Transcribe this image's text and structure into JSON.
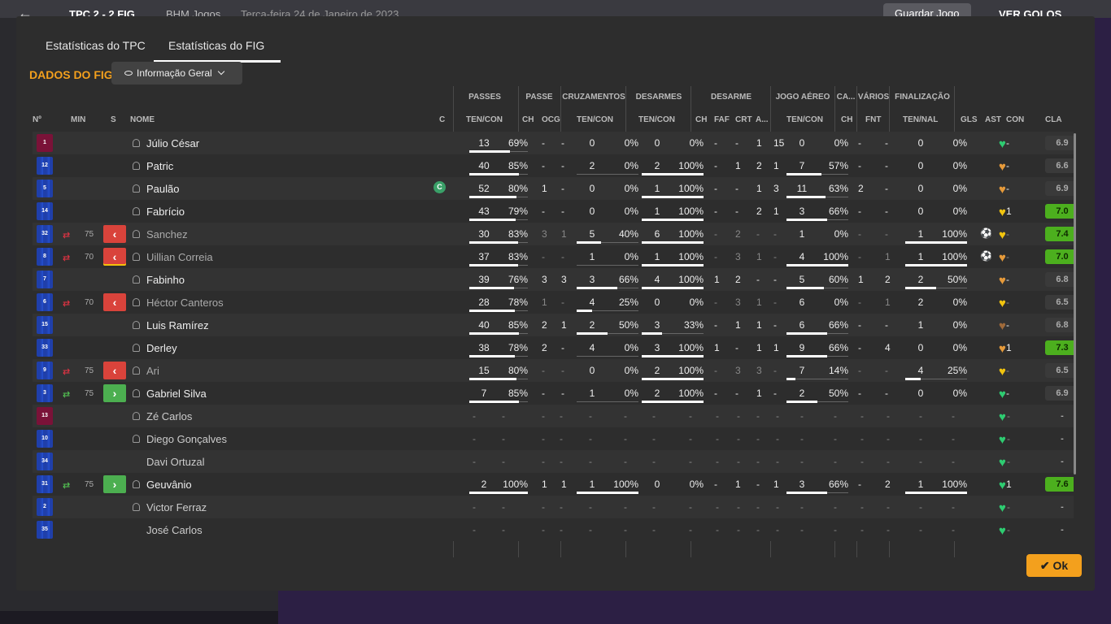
{
  "topbar": {
    "score": "TPC  2 - 2  FIG",
    "bhm": "BHM Jogos",
    "date": "Terça-feira 24 de Janeiro de 2023",
    "save": "Guardar Jogo",
    "goals": "VER GOLOS"
  },
  "tabs": [
    {
      "label": "Estatísticas do TPC"
    },
    {
      "label": "Estatísticas do FIG"
    }
  ],
  "section_title": "DADOS DO FIG",
  "dropdown": "Informação Geral",
  "groups": {
    "passes": "PASSES",
    "passe": "PASSE",
    "cruzamentos": "CRUZAMENTOS",
    "desarmes": "DESARMES",
    "desarme": "DESARME",
    "jogo_aereo": "JOGO AÉREO",
    "ca": "CA...",
    "varios": "VÁRIOS",
    "finalizacao": "FINALIZAÇÃO"
  },
  "headers": {
    "no": "Nº",
    "min": "MIN",
    "s": "S",
    "nome": "NOME",
    "c": "C",
    "passes": "TEN/CON",
    "pch": "CH",
    "pocg": "OCG",
    "cruz": "TEN/CON",
    "des": "TEN/CON",
    "dch": "CH",
    "dfaf": "FAF",
    "dcrt": "CRT",
    "da": "A...",
    "aereo": "TEN/CON",
    "cach": "CH",
    "fnt": "FNT",
    "fin": "TEN/NAL",
    "gls": "GLS",
    "ast": "AST",
    "con": "CON",
    "cla": "CLA"
  },
  "ok_label": "Ok",
  "colors": {
    "accent": "#f3a01d",
    "heart_green": "#2ecc71",
    "heart_yellow": "#f1c40f",
    "heart_orange": "#e69a3a",
    "rating_green": "#4caf1e"
  },
  "players": [
    {
      "no": "1",
      "gk": true,
      "name": "Júlio César",
      "pass": [
        "13",
        "69%"
      ],
      "pass_pct": 69,
      "pch": "-",
      "pocg": "-",
      "cruz": [
        "0",
        "0%"
      ],
      "cruz_pct": 0,
      "des": [
        "0",
        "0%"
      ],
      "des_pct": 0,
      "dch": "-",
      "dfaf": "-",
      "dcrt": "1",
      "da": "15",
      "aer": [
        "0",
        "0%"
      ],
      "aer_pct": 0,
      "cach": "-",
      "fnt": "-",
      "fin": [
        "0",
        "0%"
      ],
      "fin_pct": 0,
      "gls": "",
      "ast": "-",
      "con": "green",
      "cla": "6.9",
      "hi": false
    },
    {
      "no": "12",
      "name": "Patric",
      "pass": [
        "40",
        "85%"
      ],
      "pass_pct": 85,
      "pch": "-",
      "pocg": "-",
      "cruz": [
        "2",
        "0%"
      ],
      "cruz_pct": 0,
      "des": [
        "2",
        "100%"
      ],
      "des_pct": 100,
      "dch": "-",
      "dfaf": "1",
      "dcrt": "2",
      "da": "1",
      "aer": [
        "7",
        "57%"
      ],
      "aer_pct": 57,
      "cach": "-",
      "fnt": "-",
      "fin": [
        "0",
        "0%"
      ],
      "fin_pct": 0,
      "gls": "",
      "ast": "-",
      "con": "orange",
      "cla": "6.6",
      "hi": false
    },
    {
      "no": "5",
      "name": "Paulão",
      "captain": true,
      "pass": [
        "52",
        "80%"
      ],
      "pass_pct": 80,
      "pch": "1",
      "pocg": "-",
      "cruz": [
        "0",
        "0%"
      ],
      "cruz_pct": 0,
      "des": [
        "1",
        "100%"
      ],
      "des_pct": 100,
      "dch": "-",
      "dfaf": "-",
      "dcrt": "1",
      "da": "3",
      "aer": [
        "11",
        "63%"
      ],
      "aer_pct": 63,
      "cach": "2",
      "fnt": "-",
      "fin": [
        "0",
        "0%"
      ],
      "fin_pct": 0,
      "gls": "",
      "ast": "-",
      "con": "orange",
      "cla": "6.9",
      "hi": false
    },
    {
      "no": "14",
      "name": "Fabrício",
      "pass": [
        "43",
        "79%"
      ],
      "pass_pct": 79,
      "pch": "-",
      "pocg": "-",
      "cruz": [
        "0",
        "0%"
      ],
      "cruz_pct": 0,
      "des": [
        "1",
        "100%"
      ],
      "des_pct": 100,
      "dch": "-",
      "dfaf": "-",
      "dcrt": "2",
      "da": "1",
      "aer": [
        "3",
        "66%"
      ],
      "aer_pct": 66,
      "cach": "-",
      "fnt": "-",
      "fin": [
        "0",
        "0%"
      ],
      "fin_pct": 0,
      "gls": "",
      "ast": "1",
      "con": "yellow",
      "cla": "7.0",
      "hi": true
    },
    {
      "no": "32",
      "sub": "out",
      "min": "75",
      "name": "Sanchez",
      "dimmed": true,
      "pass": [
        "30",
        "83%"
      ],
      "pass_pct": 83,
      "pch": "3",
      "pocg": "1",
      "cruz": [
        "5",
        "40%"
      ],
      "cruz_pct": 40,
      "des": [
        "6",
        "100%"
      ],
      "des_pct": 100,
      "dch": "-",
      "dfaf": "2",
      "dcrt": "-",
      "da": "-",
      "aer": [
        "1",
        "0%"
      ],
      "aer_pct": 0,
      "cach": "-",
      "fnt": "-",
      "fin": [
        "1",
        "100%"
      ],
      "fin_pct": 100,
      "gls": "ball",
      "ast": "-",
      "con": "yellow",
      "cla": "7.4",
      "hi": true
    },
    {
      "no": "8",
      "sub": "out",
      "card": true,
      "min": "70",
      "name": "Uillian Correia",
      "dimmed": true,
      "pass": [
        "37",
        "83%"
      ],
      "pass_pct": 83,
      "pch": "-",
      "pocg": "-",
      "cruz": [
        "1",
        "0%"
      ],
      "cruz_pct": 0,
      "des": [
        "1",
        "100%"
      ],
      "des_pct": 100,
      "dch": "-",
      "dfaf": "3",
      "dcrt": "1",
      "da": "-",
      "aer": [
        "4",
        "100%"
      ],
      "aer_pct": 100,
      "cach": "-",
      "fnt": "1",
      "fin": [
        "1",
        "100%"
      ],
      "fin_pct": 100,
      "gls": "ball",
      "ast": "-",
      "con": "orange",
      "cla": "7.0",
      "hi": true
    },
    {
      "no": "7",
      "name": "Fabinho",
      "pass": [
        "39",
        "76%"
      ],
      "pass_pct": 76,
      "pch": "3",
      "pocg": "3",
      "cruz": [
        "3",
        "66%"
      ],
      "cruz_pct": 66,
      "des": [
        "4",
        "100%"
      ],
      "des_pct": 100,
      "dch": "1",
      "dfaf": "2",
      "dcrt": "-",
      "da": "-",
      "aer": [
        "5",
        "60%"
      ],
      "aer_pct": 60,
      "cach": "1",
      "fnt": "2",
      "fin": [
        "2",
        "50%"
      ],
      "fin_pct": 50,
      "gls": "",
      "ast": "-",
      "con": "orange",
      "cla": "6.8",
      "hi": false
    },
    {
      "no": "6",
      "sub": "out",
      "min": "70",
      "name": "Héctor Canteros",
      "dimmed": true,
      "pass": [
        "28",
        "78%"
      ],
      "pass_pct": 78,
      "pch": "1",
      "pocg": "-",
      "cruz": [
        "4",
        "25%"
      ],
      "cruz_pct": 25,
      "des": [
        "0",
        "0%"
      ],
      "des_pct": 0,
      "dch": "-",
      "dfaf": "3",
      "dcrt": "1",
      "da": "-",
      "aer": [
        "6",
        "0%"
      ],
      "aer_pct": 0,
      "cach": "-",
      "fnt": "1",
      "fin": [
        "2",
        "0%"
      ],
      "fin_pct": 0,
      "gls": "",
      "ast": "-",
      "con": "yellow",
      "cla": "6.5",
      "hi": false
    },
    {
      "no": "15",
      "name": "Luis Ramírez",
      "pass": [
        "40",
        "85%"
      ],
      "pass_pct": 85,
      "pch": "2",
      "pocg": "1",
      "cruz": [
        "2",
        "50%"
      ],
      "cruz_pct": 50,
      "des": [
        "3",
        "33%"
      ],
      "des_pct": 33,
      "dch": "-",
      "dfaf": "1",
      "dcrt": "1",
      "da": "-",
      "aer": [
        "6",
        "66%"
      ],
      "aer_pct": 66,
      "cach": "-",
      "fnt": "-",
      "fin": [
        "1",
        "0%"
      ],
      "fin_pct": 0,
      "gls": "",
      "ast": "-",
      "con": "brown",
      "cla": "6.8",
      "hi": false
    },
    {
      "no": "33",
      "name": "Derley",
      "pass": [
        "38",
        "78%"
      ],
      "pass_pct": 78,
      "pch": "2",
      "pocg": "-",
      "cruz": [
        "4",
        "0%"
      ],
      "cruz_pct": 0,
      "des": [
        "3",
        "100%"
      ],
      "des_pct": 100,
      "dch": "1",
      "dfaf": "-",
      "dcrt": "1",
      "da": "1",
      "aer": [
        "9",
        "66%"
      ],
      "aer_pct": 66,
      "cach": "-",
      "fnt": "4",
      "fin": [
        "0",
        "0%"
      ],
      "fin_pct": 0,
      "gls": "",
      "ast": "1",
      "con": "orange",
      "cla": "7.3",
      "hi": true
    },
    {
      "no": "9",
      "sub": "out",
      "min": "75",
      "name": "Ari",
      "dimmed": true,
      "pass": [
        "15",
        "80%"
      ],
      "pass_pct": 80,
      "pch": "-",
      "pocg": "-",
      "cruz": [
        "0",
        "0%"
      ],
      "cruz_pct": 0,
      "des": [
        "2",
        "100%"
      ],
      "des_pct": 100,
      "dch": "-",
      "dfaf": "3",
      "dcrt": "3",
      "da": "-",
      "aer": [
        "7",
        "14%"
      ],
      "aer_pct": 14,
      "cach": "-",
      "fnt": "-",
      "fin": [
        "4",
        "25%"
      ],
      "fin_pct": 25,
      "gls": "",
      "ast": "-",
      "con": "yellow",
      "cla": "6.5",
      "hi": false
    },
    {
      "no": "3",
      "sub": "in",
      "min": "75",
      "name": "Gabriel Silva",
      "pass": [
        "7",
        "85%"
      ],
      "pass_pct": 85,
      "pch": "-",
      "pocg": "-",
      "cruz": [
        "1",
        "0%"
      ],
      "cruz_pct": 0,
      "des": [
        "2",
        "100%"
      ],
      "des_pct": 100,
      "dch": "-",
      "dfaf": "-",
      "dcrt": "1",
      "da": "-",
      "aer": [
        "2",
        "50%"
      ],
      "aer_pct": 50,
      "cach": "-",
      "fnt": "-",
      "fin": [
        "0",
        "0%"
      ],
      "fin_pct": 0,
      "gls": "",
      "ast": "-",
      "con": "green",
      "cla": "6.9",
      "hi": false
    },
    {
      "no": "13",
      "gk": true,
      "name": "Zé Carlos",
      "dimmed": true,
      "empty": true,
      "con": "green",
      "cla": "-"
    },
    {
      "no": "10",
      "name": "Diego Gonçalves",
      "dimmed": true,
      "empty": true,
      "con": "green",
      "cla": "-"
    },
    {
      "no": "34",
      "name": "Davi Ortuzal",
      "nohead": true,
      "dimmed": true,
      "empty": true,
      "con": "green",
      "cla": "-"
    },
    {
      "no": "31",
      "sub": "in",
      "min": "75",
      "name": "Geuvânio",
      "pass": [
        "2",
        "100%"
      ],
      "pass_pct": 100,
      "pch": "1",
      "pocg": "1",
      "cruz": [
        "1",
        "100%"
      ],
      "cruz_pct": 100,
      "des": [
        "0",
        "0%"
      ],
      "des_pct": 0,
      "dch": "-",
      "dfaf": "1",
      "dcrt": "-",
      "da": "1",
      "aer": [
        "3",
        "66%"
      ],
      "aer_pct": 66,
      "cach": "-",
      "fnt": "2",
      "fin": [
        "1",
        "100%"
      ],
      "fin_pct": 100,
      "gls": "",
      "ast": "1",
      "con": "green",
      "cla": "7.6",
      "hi": true
    },
    {
      "no": "2",
      "name": "Victor Ferraz",
      "dimmed": true,
      "empty": true,
      "con": "green",
      "cla": "-"
    },
    {
      "no": "35",
      "name": "José Carlos",
      "nohead": true,
      "dimmed": true,
      "empty": true,
      "con": "green",
      "cla": "-"
    }
  ]
}
